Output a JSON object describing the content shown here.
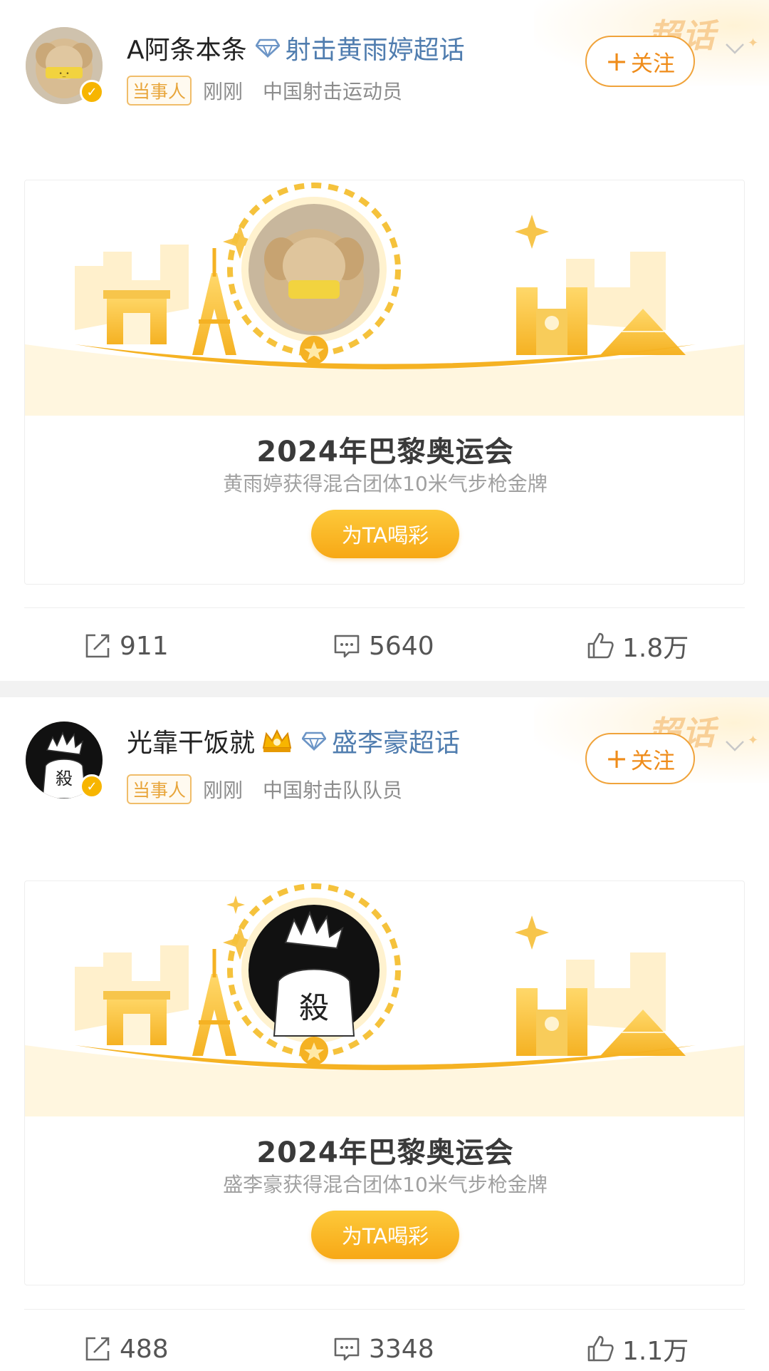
{
  "posts": [
    {
      "username": "A阿条本条",
      "topic": "射击黄雨婷超话",
      "party_tag": "当事人",
      "time": "刚刚",
      "description": "中国射击运动员",
      "follow_label": "关注",
      "follow_plus": "+",
      "corner_text": "超话",
      "card": {
        "title": "2024年巴黎奥运会",
        "subtitle": "黄雨婷获得混合团体10米气步枪金牌",
        "button": "为TA喝彩"
      },
      "stats": {
        "reposts": "911",
        "comments": "5640",
        "likes": "1.8万"
      }
    },
    {
      "username": "光靠干饭就",
      "topic": "盛李豪超话",
      "party_tag": "当事人",
      "time": "刚刚",
      "description": "中国射击队队员",
      "follow_label": "关注",
      "follow_plus": "+",
      "corner_text": "超话",
      "card": {
        "title": "2024年巴黎奥运会",
        "subtitle": "盛李豪获得混合团体10米气步枪金牌",
        "button": "为TA喝彩"
      },
      "stats": {
        "reposts": "488",
        "comments": "3348",
        "likes": "1.1万"
      }
    }
  ],
  "colors": {
    "accent_orange": "#ef8c1a",
    "topic_blue": "#507daf",
    "gold": "#f7b500",
    "meta_gray": "#8c8c8c"
  },
  "icons": {
    "repost": "repost-icon",
    "comment": "comment-icon",
    "like": "like-icon",
    "chevron": "chevron-down-icon",
    "verified": "verified-badge-icon",
    "topic": "diamond-topic-icon"
  }
}
